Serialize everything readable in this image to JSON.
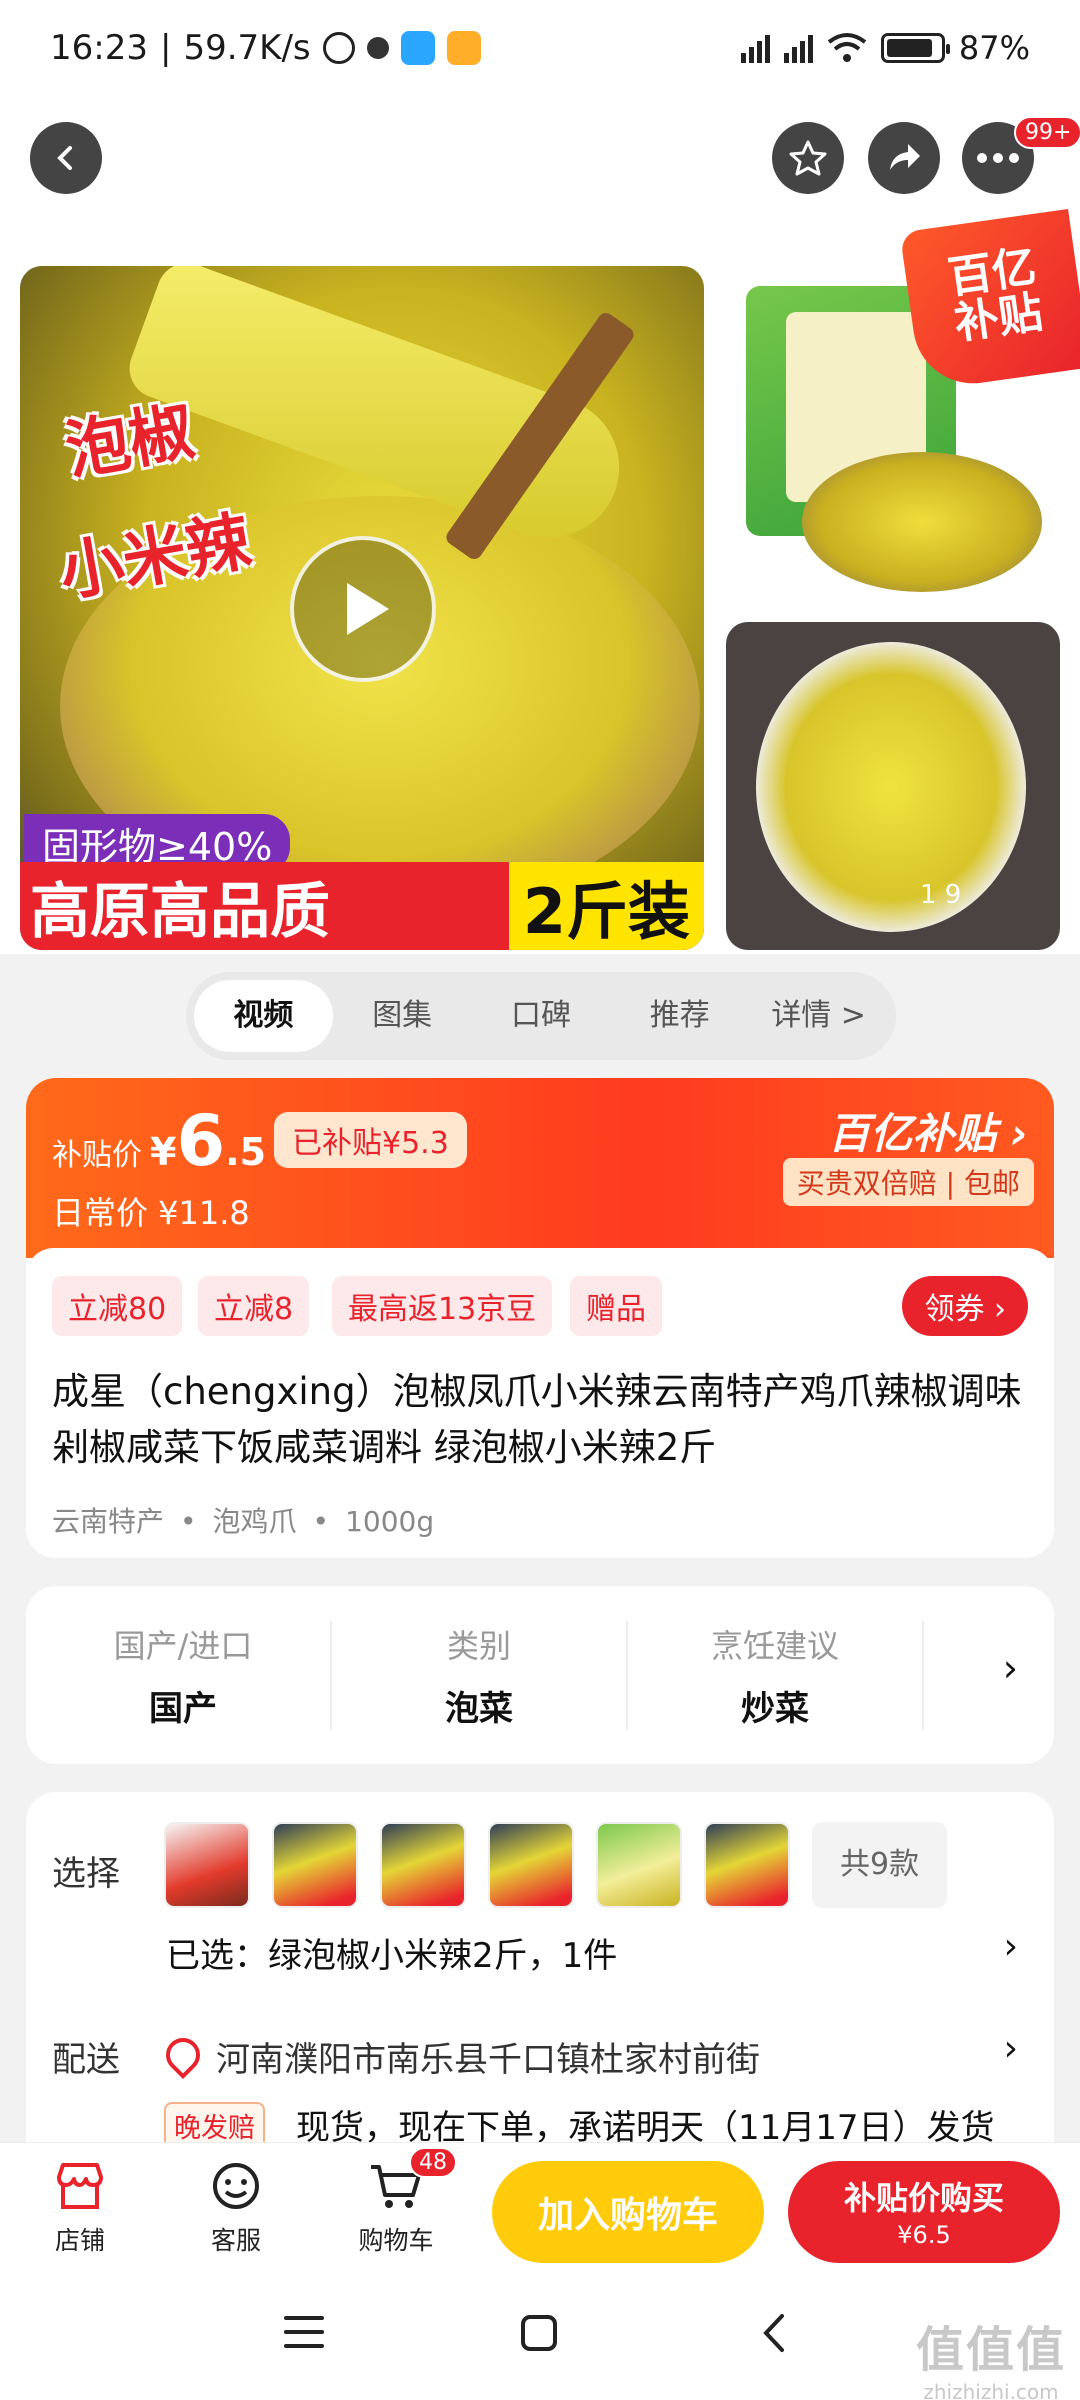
{
  "status_bar": {
    "time": "16:23",
    "separator": "|",
    "net_speed": "59.7K/s",
    "battery": "87%",
    "battery_level": 0.87
  },
  "nav": {
    "menu_badge": "99+"
  },
  "gallery": {
    "img_text_line1": "泡椒",
    "img_text_line2": "小米辣",
    "solid_tag": "固形物≥40%",
    "banner_left": "高原高品质",
    "banner_right": "2斤装",
    "corner_badge_line1": "百亿",
    "corner_badge_line2": "补贴",
    "counter": "1   9"
  },
  "tabs": [
    "视频",
    "图集",
    "口碑",
    "推荐",
    "详情 >"
  ],
  "price": {
    "label": "补贴价",
    "currency": "¥",
    "int": "6",
    "dec": ".5",
    "subsidized": "已补贴¥5.3",
    "daily": "日常价 ¥11.8",
    "brand_title": "百亿补贴 ›",
    "brand_sub": "买贵双倍赔 | 包邮"
  },
  "promos": [
    "立减80",
    "立减8",
    "最高返13京豆",
    "赠品"
  ],
  "coupon": "领券 ›",
  "product": {
    "title": "成星（chengxing）泡椒凤爪小米辣云南特产鸡爪辣椒调味剁椒咸菜下饭咸菜调料 绿泡椒小米辣2斤",
    "meta": [
      "云南特产",
      "泡鸡爪",
      "1000g"
    ],
    "meta_sep": "•"
  },
  "specs": [
    {
      "key": "国产/进口",
      "value": "国产"
    },
    {
      "key": "类别",
      "value": "泡菜"
    },
    {
      "key": "烹饪建议",
      "value": "炒菜"
    }
  ],
  "options": {
    "select_label": "选择",
    "total": "共9款",
    "selected": "已选：绿泡椒小米辣2斤，1件",
    "delivery_label": "配送",
    "address": "河南濮阳市南乐县千口镇杜家村前街",
    "late_tag": "晚发赔",
    "ship_text": "现货，现在下单，承诺明天（11月17日）发货"
  },
  "bottom_bar": {
    "store": "店铺",
    "service": "客服",
    "cart": "购物车",
    "cart_count": "48",
    "add_to_cart": "加入购物车",
    "buy_line1": "补贴价购买",
    "buy_line2": "¥6.5"
  },
  "watermark": {
    "logo": "值值值",
    "url": "zhizhizhi.com"
  },
  "colors": {
    "accent_red": "#e8232c",
    "orange": "#ff5a20",
    "yellow_button": "#ffcb0a"
  }
}
